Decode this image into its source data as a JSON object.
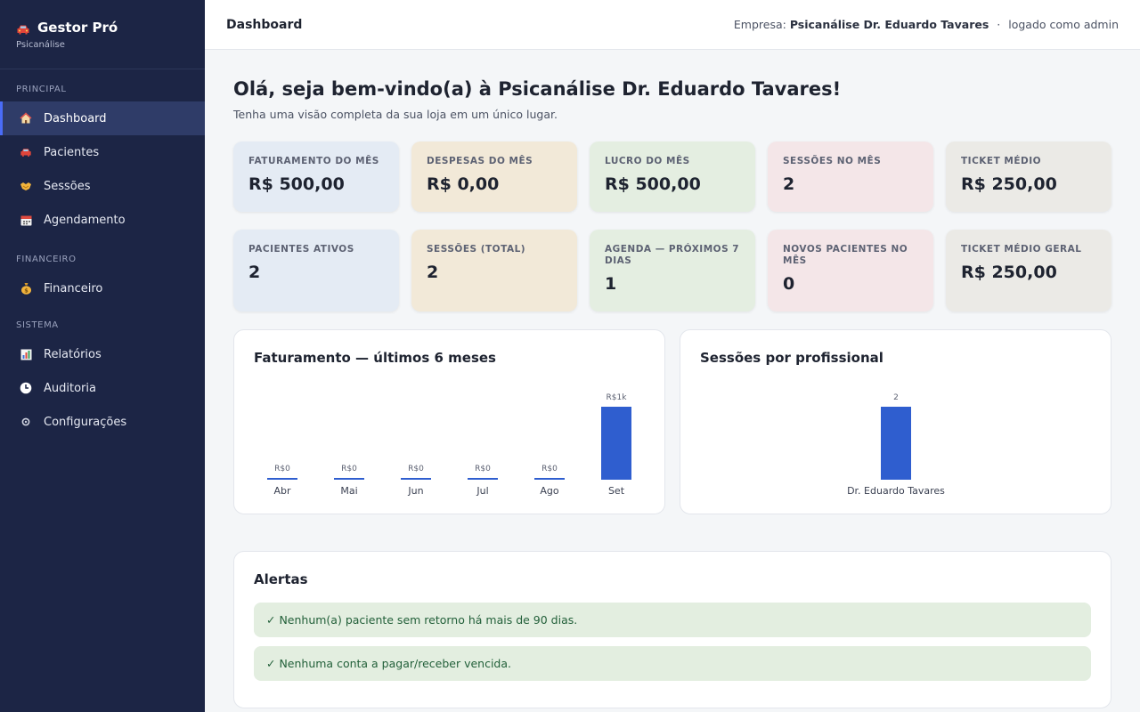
{
  "brand": {
    "name": "Gestor Pró",
    "subtitle": "Psicanálise"
  },
  "sidebar": {
    "sections": [
      {
        "label": "PRINCIPAL",
        "items": [
          {
            "label": "Dashboard",
            "icon": "home-icon",
            "active": true
          },
          {
            "label": "Pacientes",
            "icon": "car-icon"
          },
          {
            "label": "Sessões",
            "icon": "handshake-icon"
          },
          {
            "label": "Agendamento",
            "icon": "calendar-icon"
          }
        ]
      },
      {
        "label": "FINANCEIRO",
        "items": [
          {
            "label": "Financeiro",
            "icon": "money-bag-icon"
          }
        ]
      },
      {
        "label": "SISTEMA",
        "items": [
          {
            "label": "Relatórios",
            "icon": "bar-chart-icon"
          },
          {
            "label": "Auditoria",
            "icon": "clock-icon"
          },
          {
            "label": "Configurações",
            "icon": "gear-icon"
          }
        ]
      }
    ]
  },
  "topbar": {
    "title": "Dashboard",
    "company_prefix": "Empresa:",
    "company_name": "Psicanálise Dr. Eduardo Tavares",
    "separator": "·",
    "user_text": "logado como admin"
  },
  "welcome": {
    "title": "Olá, seja bem-vindo(a) à Psicanálise Dr. Eduardo Tavares!",
    "subtitle": "Tenha uma visão completa da sua loja em um único lugar."
  },
  "kpis_row1": [
    {
      "label": "FATURAMENTO DO MÊS",
      "value": "R$ 500,00",
      "color": "#e4ebf4"
    },
    {
      "label": "DESPESAS DO MÊS",
      "value": "R$ 0,00",
      "color": "#f2e9d8"
    },
    {
      "label": "LUCRO DO MÊS",
      "value": "R$ 500,00",
      "color": "#e4eee1"
    },
    {
      "label": "SESSÕES NO MÊS",
      "value": "2",
      "color": "#f4e6e8"
    },
    {
      "label": "TICKET MÉDIO",
      "value": "R$ 250,00",
      "color": "#ebeae6"
    }
  ],
  "kpis_row2": [
    {
      "label": "PACIENTES ATIVOS",
      "value": "2",
      "color": "#e4ebf4"
    },
    {
      "label": "SESSÕES (TOTAL)",
      "value": "2",
      "color": "#f2e9d8"
    },
    {
      "label": "AGENDA — PRÓXIMOS 7 DIAS",
      "value": "1",
      "color": "#e4eee1"
    },
    {
      "label": "NOVOS PACIENTES NO MÊS",
      "value": "0",
      "color": "#f4e6e8"
    },
    {
      "label": "TICKET MÉDIO GERAL",
      "value": "R$ 250,00",
      "color": "#ebeae6"
    }
  ],
  "chart_data": [
    {
      "type": "bar",
      "title": "Faturamento — últimos 6 meses",
      "categories": [
        "Abr",
        "Mai",
        "Jun",
        "Jul",
        "Ago",
        "Set"
      ],
      "values": [
        0,
        0,
        0,
        0,
        0,
        500
      ],
      "data_labels": [
        "R$0",
        "R$0",
        "R$0",
        "R$0",
        "R$0",
        "R$1k"
      ],
      "bar_color": "#2f5ecf"
    },
    {
      "type": "bar",
      "title": "Sessões por profissional",
      "categories": [
        "Dr. Eduardo Tavares"
      ],
      "values": [
        2
      ],
      "data_labels": [
        "2"
      ],
      "bar_color": "#2f5ecf"
    }
  ],
  "alerts": {
    "title": "Alertas",
    "items": [
      "✓ Nenhum(a) paciente sem retorno há mais de 90 dias.",
      "✓ Nenhuma conta a pagar/receber vencida."
    ]
  }
}
